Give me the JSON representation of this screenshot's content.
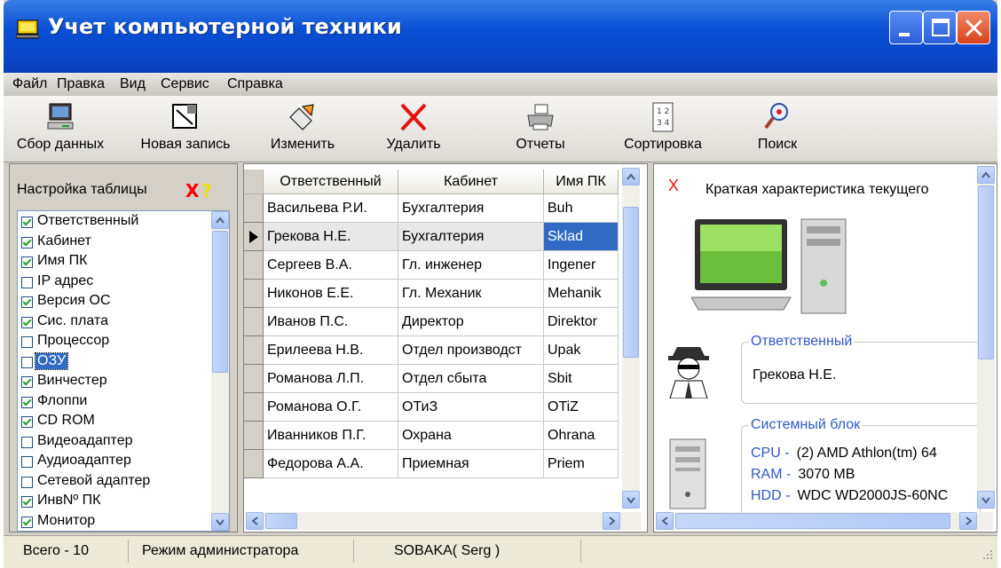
{
  "window": {
    "title": "Учет компьютерной техники"
  },
  "menu": [
    "Файл",
    "Правка",
    "Вид",
    "Сервис",
    "Справка"
  ],
  "toolbar": {
    "collect": "Сбор данных",
    "new_record": "Новая запись",
    "edit": "Изменить",
    "delete": "Удалить",
    "reports": "Отчеты",
    "sort": "Сортировка",
    "search": "Поиск"
  },
  "table_settings": {
    "title": "Настройка таблицы",
    "close_mark": "X",
    "help_mark": "?",
    "items": [
      {
        "label": "Ответственный",
        "checked": true
      },
      {
        "label": "Кабинет",
        "checked": true
      },
      {
        "label": "Имя ПК",
        "checked": true
      },
      {
        "label": "IP адрес",
        "checked": false
      },
      {
        "label": "Версия ОС",
        "checked": true
      },
      {
        "label": "Сис. плата",
        "checked": true
      },
      {
        "label": "Процессор",
        "checked": false
      },
      {
        "label": "ОЗУ",
        "checked": false
      },
      {
        "label": "Винчестер",
        "checked": true
      },
      {
        "label": "Флоппи",
        "checked": true
      },
      {
        "label": "CD ROM",
        "checked": true
      },
      {
        "label": "Видеоадаптер",
        "checked": false
      },
      {
        "label": "Аудиоадаптер",
        "checked": false
      },
      {
        "label": "Сетевой адаптер",
        "checked": false
      },
      {
        "label": "ИнвNº ПК",
        "checked": true
      },
      {
        "label": "Монитор",
        "checked": true
      }
    ],
    "selected_index": 7
  },
  "grid": {
    "columns": [
      "Ответственный",
      "Кабинет",
      "Имя ПК"
    ],
    "rows": [
      [
        "Васильева Р.И.",
        "Бухгалтерия",
        "Buh"
      ],
      [
        "Грекова Н.Е.",
        "Бухгалтерия",
        "Sklad"
      ],
      [
        "Сергеев В.А.",
        "Гл. инженер",
        "Ingener"
      ],
      [
        "Никонов Е.Е.",
        "Гл. Механик",
        "Mehanik"
      ],
      [
        "Иванов П.С.",
        "Директор",
        "Direktor"
      ],
      [
        "Ерилеева Н.В.",
        "Отдел производст",
        "Upak"
      ],
      [
        "Романова Л.П.",
        "Отдел сбыта",
        "Sbit"
      ],
      [
        "Романова О.Г.",
        "ОТиЗ",
        "OTiZ"
      ],
      [
        "Иванников П.Г.",
        "Охрана",
        "Ohrana"
      ],
      [
        "Федорова А.А.",
        "Приемная",
        "Priem"
      ]
    ],
    "current_row": 1
  },
  "details": {
    "close_mark": "X",
    "heading": "Краткая характеристика текущего",
    "responsible": {
      "legend": "Ответственный",
      "value": "Грекова Н.Е."
    },
    "system_unit": {
      "legend": "Системный блок",
      "specs": [
        {
          "key": "CPU -",
          "value": "(2) AMD Athlon(tm) 64"
        },
        {
          "key": "RAM -",
          "value": "3070 MB"
        },
        {
          "key": "HDD -",
          "value": "WDC WD2000JS-60NC"
        }
      ]
    }
  },
  "status": {
    "total": "Всего - 10",
    "mode": "Режим администратора",
    "user": "SOBAKA( Serg )"
  }
}
